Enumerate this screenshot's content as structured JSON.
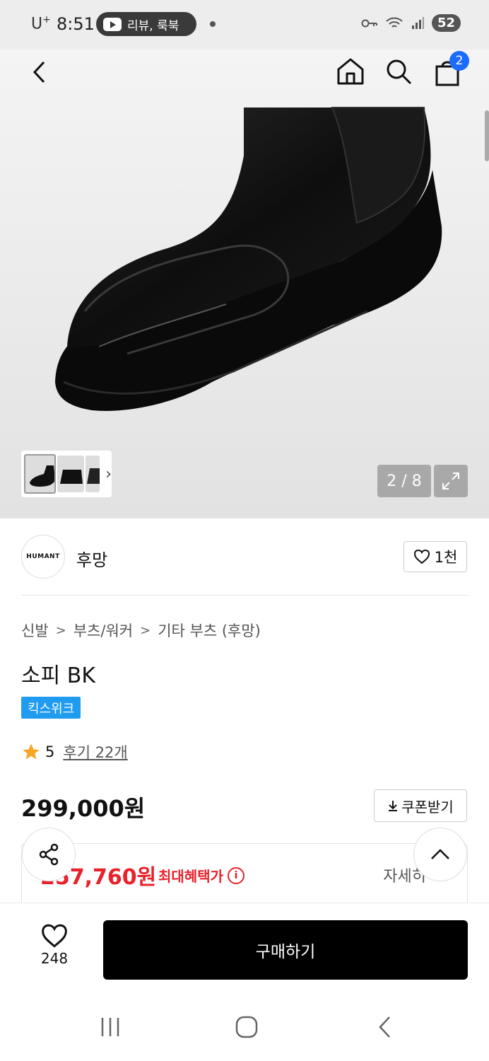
{
  "status_bar": {
    "carrier": "U",
    "carrier_sup": "+",
    "time": "8:51",
    "media_text": "리뷰, 룩북",
    "battery": "52"
  },
  "nav": {
    "cart_count": "2"
  },
  "gallery": {
    "page_indicator": "2 / 8",
    "thumb_arrow": "›"
  },
  "brand": {
    "logo_text": "HUMANT",
    "name": "후망",
    "like_count": "1천"
  },
  "breadcrumb": {
    "items": [
      "신발",
      "부츠/워커",
      "기타 부츠 (후망)"
    ],
    "separator": ">"
  },
  "product": {
    "title": "소피 BK",
    "tag": "킥스위크",
    "rating": "5",
    "reviews": "후기 22개",
    "price": "299,000원",
    "coupon_label": "쿠폰받기",
    "benefit_price": "257,760원",
    "benefit_label": "최대혜택가",
    "benefit_more": "자세히"
  },
  "bottom": {
    "wish_count": "248",
    "buy_label": "구매하기"
  },
  "colors": {
    "accent_blue": "#1b6bff",
    "tag_blue": "#1f9bf0",
    "sale_red": "#e8212b",
    "buy_black": "#000000"
  }
}
